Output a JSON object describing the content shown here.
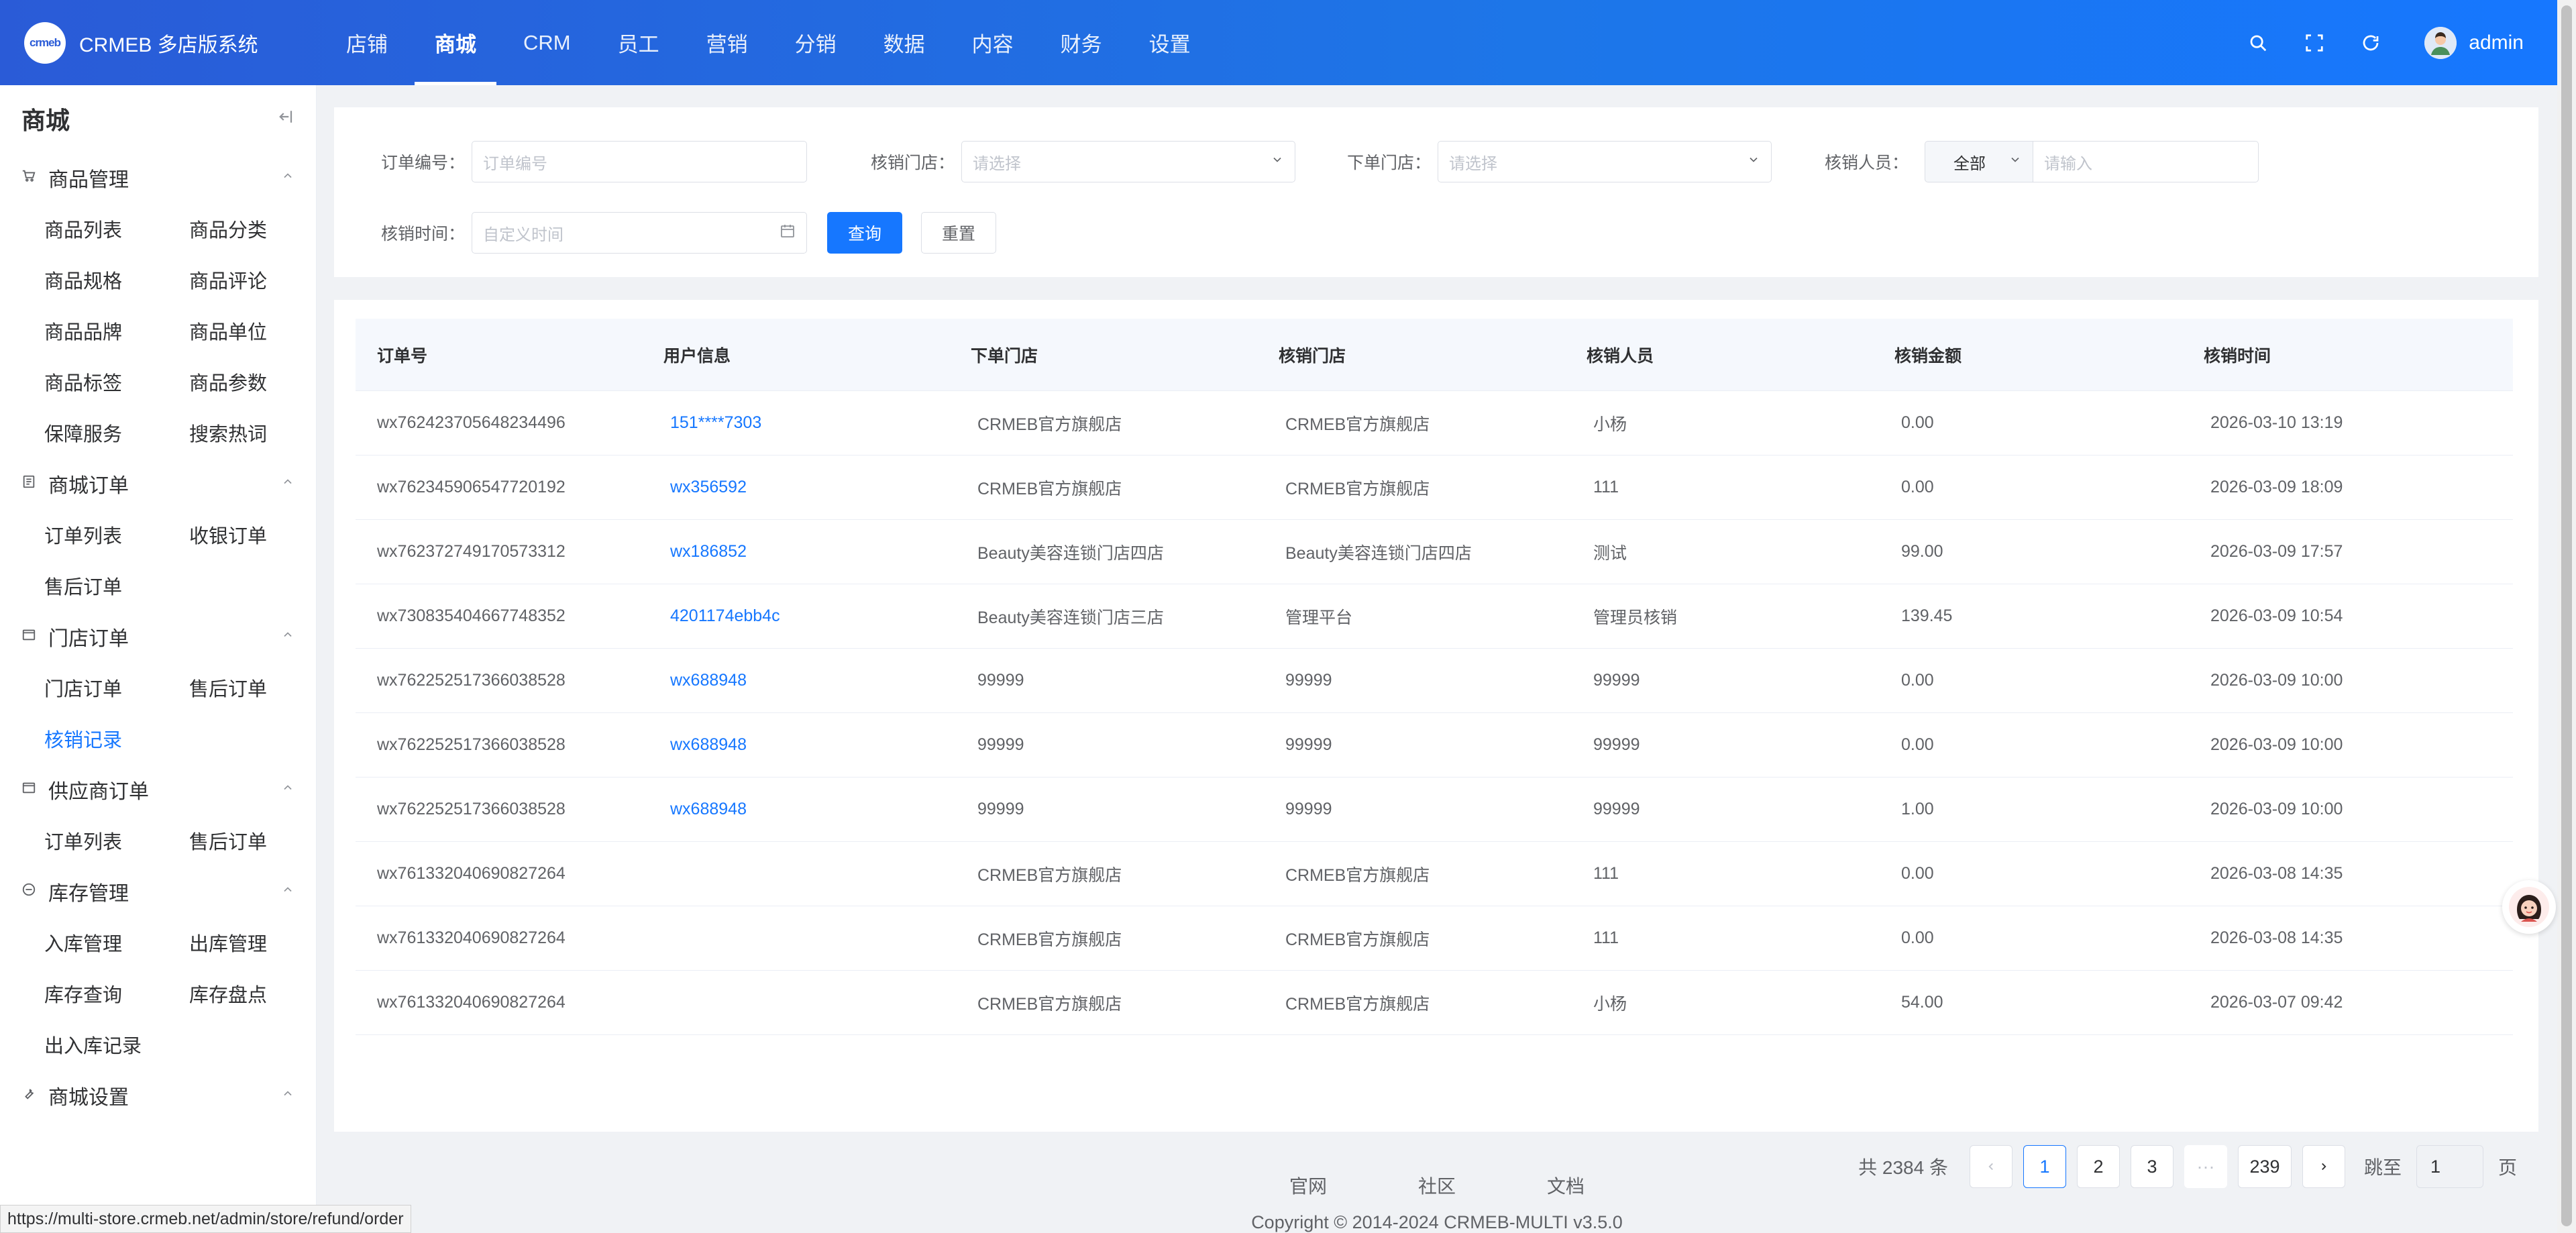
{
  "app": {
    "logo_text": "crmeb",
    "title": "CRMEB 多店版系统",
    "admin": "admin"
  },
  "topnav": [
    "店铺",
    "商城",
    "CRM",
    "员工",
    "营销",
    "分销",
    "数据",
    "内容",
    "财务",
    "设置"
  ],
  "sidebar": {
    "title": "商城",
    "groups": [
      {
        "label": "商品管理",
        "icon": "cart-icon",
        "items": [
          "商品列表",
          "商品分类",
          "商品规格",
          "商品评论",
          "商品品牌",
          "商品单位",
          "商品标签",
          "商品参数",
          "保障服务",
          "搜索热词"
        ]
      },
      {
        "label": "商城订单",
        "icon": "document-icon",
        "items": [
          "订单列表",
          "收银订单",
          "售后订单"
        ]
      },
      {
        "label": "门店订单",
        "icon": "store-icon",
        "items": [
          "门店订单",
          "售后订单",
          "核销记录"
        ]
      },
      {
        "label": "供应商订单",
        "icon": "store-icon",
        "items": [
          "订单列表",
          "售后订单"
        ]
      },
      {
        "label": "库存管理",
        "icon": "stock-icon",
        "items": [
          "入库管理",
          "出库管理",
          "库存查询",
          "库存盘点",
          "出入库记录"
        ]
      },
      {
        "label": "商城设置",
        "icon": "wrench-icon",
        "items": []
      }
    ],
    "active_item": "核销记录"
  },
  "filters": {
    "order_no": {
      "label": "订单编号：",
      "placeholder": "订单编号"
    },
    "verify_store": {
      "label": "核销门店：",
      "placeholder": "请选择"
    },
    "order_store": {
      "label": "下单门店：",
      "placeholder": "请选择"
    },
    "verifier": {
      "label": "核销人员：",
      "select_value": "全部",
      "placeholder": "请输入"
    },
    "verify_time": {
      "label": "核销时间：",
      "placeholder": "自定义时间"
    },
    "query_label": "查询",
    "reset_label": "重置"
  },
  "table": {
    "headers": [
      "订单号",
      "用户信息",
      "下单门店",
      "核销门店",
      "核销人员",
      "核销金额",
      "核销时间"
    ],
    "rows": [
      [
        "wx762423705648234496",
        "151****7303",
        "CRMEB官方旗舰店",
        "CRMEB官方旗舰店",
        "小杨",
        "0.00",
        "2026-03-10 13:19"
      ],
      [
        "wx762345906547720192",
        "wx356592",
        "CRMEB官方旗舰店",
        "CRMEB官方旗舰店",
        "111",
        "0.00",
        "2026-03-09 18:09"
      ],
      [
        "wx762372749170573312",
        "wx186852",
        "Beauty美容连锁门店四店",
        "Beauty美容连锁门店四店",
        "测试",
        "99.00",
        "2026-03-09 17:57"
      ],
      [
        "wx730835404667748352",
        "4201174ebb4c",
        "Beauty美容连锁门店三店",
        "管理平台",
        "管理员核销",
        "139.45",
        "2026-03-09 10:54"
      ],
      [
        "wx762252517366038528",
        "wx688948",
        "99999",
        "99999",
        "99999",
        "0.00",
        "2026-03-09 10:00"
      ],
      [
        "wx762252517366038528",
        "wx688948",
        "99999",
        "99999",
        "99999",
        "0.00",
        "2026-03-09 10:00"
      ],
      [
        "wx762252517366038528",
        "wx688948",
        "99999",
        "99999",
        "99999",
        "1.00",
        "2026-03-09 10:00"
      ],
      [
        "wx761332040690827264",
        "",
        "CRMEB官方旗舰店",
        "CRMEB官方旗舰店",
        "111",
        "0.00",
        "2026-03-08 14:35"
      ],
      [
        "wx761332040690827264",
        "",
        "CRMEB官方旗舰店",
        "CRMEB官方旗舰店",
        "111",
        "0.00",
        "2026-03-08 14:35"
      ],
      [
        "wx761332040690827264",
        "",
        "CRMEB官方旗舰店",
        "CRMEB官方旗舰店",
        "小杨",
        "54.00",
        "2026-03-07 09:42"
      ]
    ]
  },
  "pagination": {
    "total": "共 2384 条",
    "pages": [
      "1",
      "2",
      "3",
      "···",
      "239"
    ],
    "current": "1",
    "jump_label": "跳至",
    "jump_value": "1",
    "page_unit": "页"
  },
  "footer": {
    "links": [
      "官网",
      "社区",
      "文档"
    ],
    "copyright": "Copyright © 2014-2024 CRMEB-MULTI v3.5.0"
  },
  "status_url": "https://multi-store.crmeb.net/admin/store/refund/order",
  "colors": {
    "primary": "#1677ff",
    "topbar_start": "#2a5bd7",
    "link": "#1677ff"
  }
}
